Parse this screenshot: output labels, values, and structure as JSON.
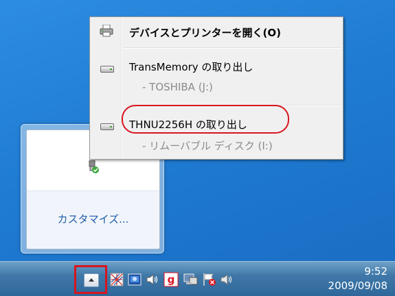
{
  "menu": {
    "open_devices": "デバイスとプリンターを開く(O)",
    "eject_transmemory": "TransMemory の取り出し",
    "transmemory_sub": "- TOSHIBA (J:)",
    "eject_thnu": "THNU2256H の取り出し",
    "thnu_sub": "- リムーバブル ディスク (I:)"
  },
  "tray_popup": {
    "customize": "カスタマイズ..."
  },
  "clock": {
    "time": "9:52",
    "date": "2009/09/08"
  },
  "colors": {
    "highlight_red": "#d9141e",
    "desktop_blue": "#1f7bd2"
  },
  "icons": [
    "printer-icon",
    "usb-drive-icon",
    "safely-remove-hardware-icon",
    "show-hidden-icons-button",
    "network-icon",
    "action-center-icon",
    "volume-icon",
    "g-app-icon",
    "display-icon",
    "flag-icon"
  ]
}
